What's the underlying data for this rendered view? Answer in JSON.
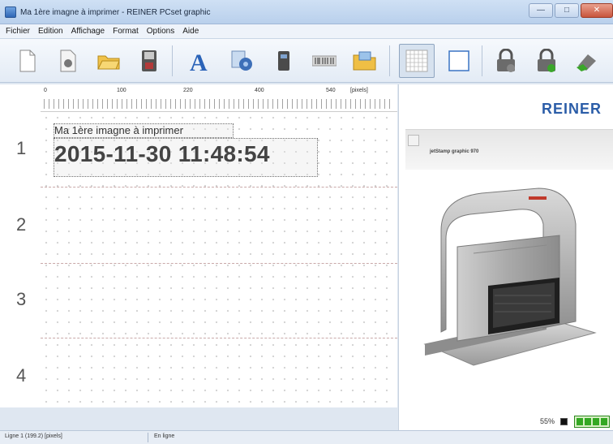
{
  "window": {
    "title": "Ma 1ère imagne à imprimer - REINER PCset graphic",
    "minimize_glyph": "—",
    "maximize_glyph": "□",
    "close_glyph": "✕"
  },
  "menu": [
    "Fichier",
    "Edition",
    "Affichage",
    "Format",
    "Options",
    "Aide"
  ],
  "toolbar": {
    "buttons": [
      "new-document-icon",
      "open-document-icon",
      "open-folder-icon",
      "save-icon",
      "text-tool-icon",
      "image-tool-icon",
      "counter-tool-icon",
      "barcode-tool-icon",
      "import-folder-icon",
      "grid-toggle-icon",
      "frame-toggle-icon",
      "lock-device-icon",
      "unlock-device-icon",
      "transfer-device-icon"
    ],
    "grid_pressed": true
  },
  "ruler": {
    "labels": [
      "0",
      "100",
      "220",
      "400",
      "540",
      "[pixels]"
    ]
  },
  "rows": [
    "1",
    "2",
    "3",
    "4"
  ],
  "canvas": {
    "field_title": "Ma 1ère imagne à imprimer",
    "field_datetime": "2015-11-30 11:48:54"
  },
  "device_panel": {
    "brand": "REINER",
    "model_name": "jetStamp graphic 970",
    "battery_percent": "55%",
    "battery_level": 1.0,
    "battery_color": "#34a823"
  },
  "status": {
    "position": "Ligne 1 (199.2) [pixels]",
    "device_state": "En ligne"
  },
  "colors": {
    "brand": "#2b5da8",
    "title_bar": "#b9d0ec"
  }
}
